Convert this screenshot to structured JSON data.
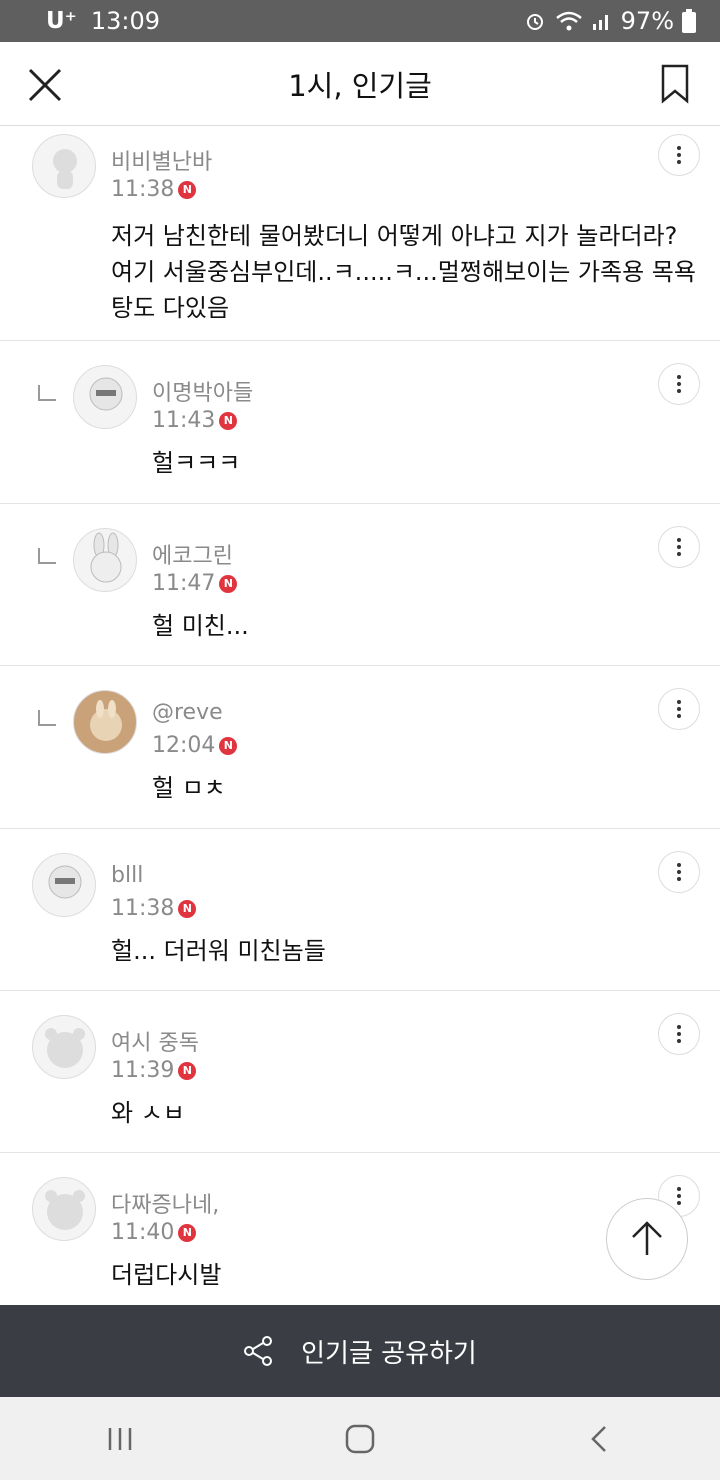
{
  "status_bar": {
    "carrier": "U⁺",
    "time": "13:09",
    "battery": "97%"
  },
  "header": {
    "title": "1시, 인기글"
  },
  "comments": [
    {
      "name": "비비별난바",
      "time": "11:38",
      "text": "저거 남친한테 물어봤더니 어떻게 아냐고 지가 놀라더라?여기 서울중심부인데..ㅋ.....ㅋ...멀쩡해보이는 가족용 목욕탕도 다있음",
      "reply": false,
      "new_badge": "N"
    },
    {
      "name": "이명박아들",
      "time": "11:43",
      "text": "헐ㅋㅋㅋ",
      "reply": true,
      "new_badge": "N"
    },
    {
      "name": "에코그린",
      "time": "11:47",
      "text": "헐 미친...",
      "reply": true,
      "new_badge": "N"
    },
    {
      "name": "@reve",
      "time": "12:04",
      "text": "헐 ㅁㅊ",
      "reply": true,
      "new_badge": "N"
    },
    {
      "name": "blll",
      "time": "11:38",
      "text": "헐... 더러워 미친놈들",
      "reply": false,
      "new_badge": "N"
    },
    {
      "name": "여시 중독",
      "time": "11:39",
      "text": "와 ㅅㅂ",
      "reply": false,
      "new_badge": "N"
    },
    {
      "name": "다짜증나네,",
      "time": "11:40",
      "text": "더럽다시발",
      "reply": false,
      "new_badge": "N"
    }
  ],
  "share_bar": {
    "label": "인기글 공유하기"
  },
  "icons": [
    "close-icon",
    "bookmark-icon",
    "more-icon",
    "arrow-up-icon",
    "share-icon",
    "recents-icon",
    "home-icon",
    "back-icon"
  ]
}
